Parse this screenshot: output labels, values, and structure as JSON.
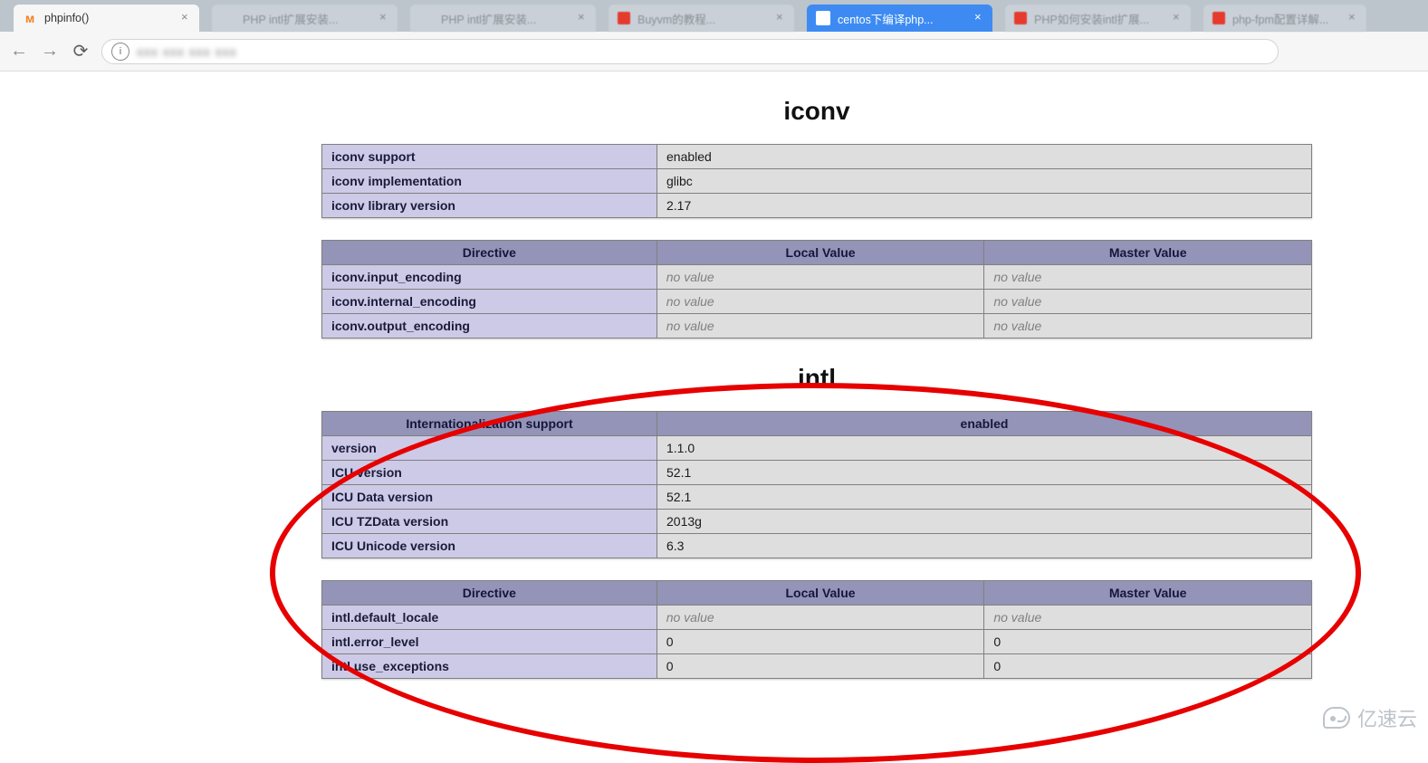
{
  "browser": {
    "tabs": [
      {
        "title": "phpinfo()",
        "active": true,
        "favicon": "moodle"
      },
      {
        "title": "PHP intl扩展安装...",
        "active": false,
        "favicon": ""
      },
      {
        "title": "PHP intl扩展安装...",
        "active": false,
        "favicon": ""
      },
      {
        "title": "Buyvm的教程...",
        "active": false,
        "favicon": "red"
      },
      {
        "title": "centos下编译php...",
        "active": false,
        "favicon": "blue",
        "highlight": true
      },
      {
        "title": "PHP如何安装intl扩展...",
        "active": false,
        "favicon": "red"
      },
      {
        "title": "php-fpm配置详解...",
        "active": false,
        "favicon": "red"
      }
    ],
    "url_blurred": "xxx xxx xxx xxx"
  },
  "phpinfo": {
    "sections": [
      {
        "title": "iconv",
        "info_rows": [
          {
            "name": "iconv support",
            "value": "enabled"
          },
          {
            "name": "iconv implementation",
            "value": "glibc"
          },
          {
            "name": "iconv library version",
            "value": "2.17"
          }
        ],
        "directive_headers": [
          "Directive",
          "Local Value",
          "Master Value"
        ],
        "directive_rows": [
          {
            "name": "iconv.input_encoding",
            "local": "no value",
            "master": "no value",
            "no_local": true,
            "no_master": true
          },
          {
            "name": "iconv.internal_encoding",
            "local": "no value",
            "master": "no value",
            "no_local": true,
            "no_master": true
          },
          {
            "name": "iconv.output_encoding",
            "local": "no value",
            "master": "no value",
            "no_local": true,
            "no_master": true
          }
        ]
      },
      {
        "title": "intl",
        "head_row": {
          "left": "Internationalization support",
          "right": "enabled"
        },
        "info_rows": [
          {
            "name": "version",
            "value": "1.1.0"
          },
          {
            "name": "ICU version",
            "value": "52.1"
          },
          {
            "name": "ICU Data version",
            "value": "52.1"
          },
          {
            "name": "ICU TZData version",
            "value": "2013g"
          },
          {
            "name": "ICU Unicode version",
            "value": "6.3"
          }
        ],
        "directive_headers": [
          "Directive",
          "Local Value",
          "Master Value"
        ],
        "directive_rows": [
          {
            "name": "intl.default_locale",
            "local": "no value",
            "master": "no value",
            "no_local": true,
            "no_master": true
          },
          {
            "name": "intl.error_level",
            "local": "0",
            "master": "0"
          },
          {
            "name": "intl.use_exceptions",
            "local": "0",
            "master": "0"
          }
        ]
      }
    ]
  },
  "watermark": "亿速云"
}
